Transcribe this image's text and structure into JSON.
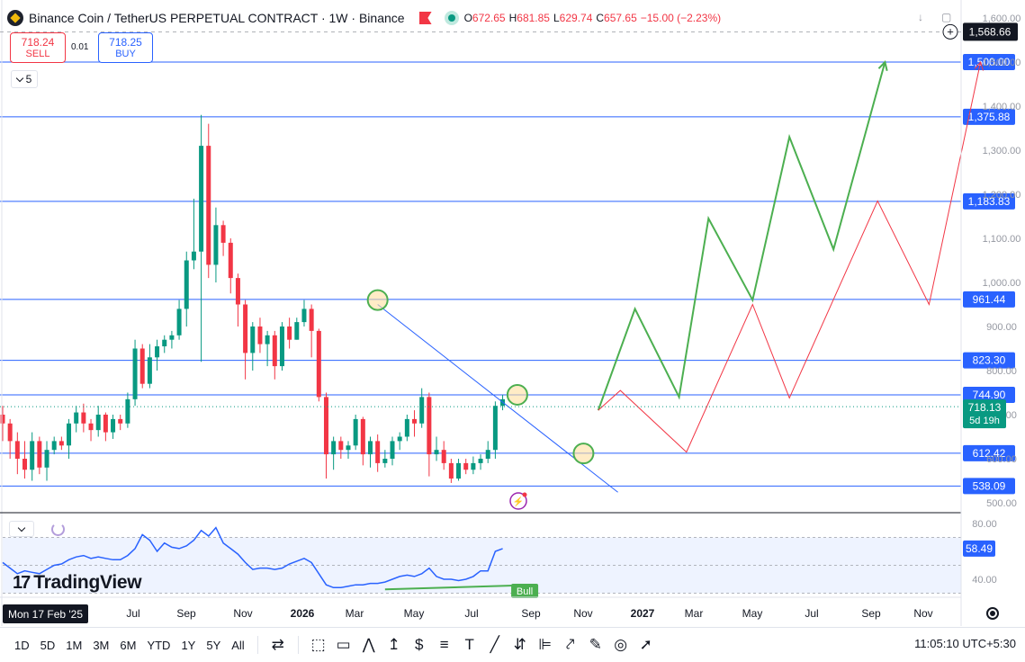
{
  "header": {
    "symbol_title": "Binance Coin / TetherUS PERPETUAL CONTRACT · 1W · Binance",
    "ohlc": [
      {
        "k": "O",
        "v": "672.65"
      },
      {
        "k": "H",
        "v": "681.85"
      },
      {
        "k": "L",
        "v": "629.74"
      },
      {
        "k": "C",
        "v": "657.65"
      },
      {
        "k": "",
        "v": "−15.00 (−2.23%)"
      }
    ],
    "sell_price": "718.24",
    "sell_label": "SELL",
    "spread": "0.01",
    "buy_price": "718.25",
    "buy_label": "BUY",
    "collapse_count": "5"
  },
  "colors": {
    "up": "#089981",
    "down": "#f23645",
    "hline": "#2962ff",
    "proj_green": "#4caf50",
    "proj_red": "#f23645",
    "rsi": "#2962ff",
    "axis_label_bg": "#2962ff",
    "last_price_bg": "#089981"
  },
  "chart_data": {
    "type": "candlestick",
    "price_axis": {
      "ticks": [
        500,
        600,
        700,
        800,
        900,
        1000,
        1100,
        1200,
        1300,
        1400,
        1500,
        1600
      ],
      "tick_labels": [
        "500.00",
        "600.00",
        "700.00",
        "800.00",
        "900.00",
        "1,000.00",
        "1,100.00",
        "1,200.00",
        "1,300.00",
        "1,400.00",
        "1,500.00",
        "1,600.00"
      ]
    },
    "time_axis": [
      "Jul",
      "Sep",
      "Nov",
      "2026",
      "Mar",
      "May",
      "Jul",
      "Sep",
      "Nov",
      "2027",
      "Mar",
      "May",
      "Jul",
      "Sep",
      "Nov"
    ],
    "crosshair_date": "Mon 17 Feb '25",
    "crosshair_price": "1,568.66",
    "last_price": "718.13",
    "countdown": "5d 19h",
    "levels": [
      {
        "price": 1500.0,
        "label": "1,500.00"
      },
      {
        "price": 1375.88,
        "label": "1,375.88"
      },
      {
        "price": 1183.83,
        "label": "1,183.83"
      },
      {
        "price": 961.44,
        "label": "961.44"
      },
      {
        "price": 823.3,
        "label": "823.30"
      },
      {
        "price": 744.9,
        "label": "744.90"
      },
      {
        "price": 612.42,
        "label": "612.42"
      },
      {
        "price": 538.09,
        "label": "538.09"
      }
    ],
    "candles": [
      [
        700,
        680,
        720,
        640
      ],
      [
        680,
        640,
        690,
        600
      ],
      [
        640,
        600,
        660,
        565
      ],
      [
        600,
        575,
        640,
        555
      ],
      [
        575,
        640,
        660,
        550
      ],
      [
        640,
        580,
        650,
        565
      ],
      [
        580,
        620,
        640,
        550
      ],
      [
        620,
        640,
        650,
        610
      ],
      [
        640,
        630,
        650,
        620
      ],
      [
        630,
        680,
        690,
        600
      ],
      [
        680,
        705,
        720,
        660
      ],
      [
        705,
        680,
        725,
        660
      ],
      [
        680,
        665,
        690,
        640
      ],
      [
        665,
        700,
        720,
        650
      ],
      [
        700,
        660,
        705,
        640
      ],
      [
        660,
        690,
        700,
        645
      ],
      [
        690,
        680,
        700,
        665
      ],
      [
        680,
        735,
        750,
        670
      ],
      [
        735,
        850,
        870,
        720
      ],
      [
        850,
        770,
        860,
        760
      ],
      [
        770,
        830,
        860,
        760
      ],
      [
        830,
        855,
        870,
        800
      ],
      [
        855,
        870,
        880,
        840
      ],
      [
        870,
        880,
        890,
        850
      ],
      [
        880,
        940,
        960,
        870
      ],
      [
        940,
        1050,
        1070,
        900
      ],
      [
        1050,
        1070,
        1190,
        1030
      ],
      [
        1070,
        1310,
        1380,
        820
      ],
      [
        1310,
        1040,
        1360,
        1010
      ],
      [
        1040,
        1130,
        1170,
        1000
      ],
      [
        1130,
        1090,
        1140,
        1060
      ],
      [
        1090,
        1010,
        1100,
        975
      ],
      [
        1010,
        950,
        1020,
        900
      ],
      [
        950,
        840,
        960,
        780
      ],
      [
        840,
        900,
        910,
        800
      ],
      [
        900,
        860,
        920,
        840
      ],
      [
        860,
        880,
        890,
        810
      ],
      [
        880,
        810,
        890,
        780
      ],
      [
        810,
        900,
        910,
        800
      ],
      [
        900,
        870,
        920,
        850
      ],
      [
        870,
        910,
        920,
        870
      ],
      [
        910,
        940,
        960,
        900
      ],
      [
        940,
        890,
        950,
        830
      ],
      [
        890,
        740,
        895,
        730
      ],
      [
        740,
        610,
        750,
        555
      ],
      [
        610,
        640,
        650,
        575
      ],
      [
        640,
        620,
        650,
        600
      ],
      [
        620,
        630,
        640,
        600
      ],
      [
        630,
        690,
        700,
        620
      ],
      [
        690,
        610,
        695,
        585
      ],
      [
        610,
        640,
        650,
        580
      ],
      [
        640,
        590,
        655,
        570
      ],
      [
        590,
        600,
        620,
        580
      ],
      [
        600,
        640,
        650,
        585
      ],
      [
        640,
        650,
        660,
        620
      ],
      [
        650,
        690,
        700,
        640
      ],
      [
        690,
        680,
        710,
        650
      ],
      [
        680,
        740,
        760,
        670
      ],
      [
        740,
        610,
        750,
        560
      ],
      [
        610,
        620,
        650,
        595
      ],
      [
        620,
        590,
        640,
        575
      ],
      [
        590,
        555,
        600,
        545
      ],
      [
        555,
        590,
        600,
        550
      ],
      [
        590,
        575,
        600,
        565
      ],
      [
        575,
        590,
        605,
        565
      ],
      [
        590,
        600,
        610,
        575
      ],
      [
        600,
        620,
        640,
        590
      ],
      [
        620,
        720,
        730,
        600
      ],
      [
        720,
        735,
        745,
        710
      ]
    ],
    "trendline": {
      "from": [
        51,
        950
      ],
      "to": [
        80,
        575
      ]
    },
    "circles": [
      [
        51,
        960
      ],
      [
        70,
        745
      ],
      [
        79,
        612
      ]
    ],
    "green_projection": [
      [
        81,
        710
      ],
      [
        86,
        940
      ],
      [
        92,
        740
      ],
      [
        96,
        1145
      ],
      [
        102,
        960
      ],
      [
        107,
        1330
      ],
      [
        113,
        1075
      ],
      [
        120,
        1500
      ]
    ],
    "red_projection": [
      [
        81,
        710
      ],
      [
        84,
        755
      ],
      [
        93,
        615
      ],
      [
        102,
        950
      ],
      [
        107,
        738
      ],
      [
        119,
        1185
      ],
      [
        126,
        950
      ],
      [
        133,
        1500
      ]
    ],
    "rsi": {
      "value_label": "58.49",
      "ticks": [
        80,
        40
      ],
      "tick_labels": [
        "80.00",
        "40.00"
      ],
      "band": [
        70,
        30
      ],
      "values": [
        52,
        48,
        44,
        46,
        45,
        44,
        47,
        50,
        51,
        54,
        56,
        57,
        55,
        56,
        55,
        54,
        54,
        57,
        62,
        72,
        68,
        60,
        66,
        63,
        62,
        64,
        68,
        75,
        71,
        77,
        66,
        62,
        58,
        52,
        47,
        48,
        48,
        47,
        48,
        51,
        53,
        55,
        52,
        44,
        36,
        34,
        34,
        35,
        36,
        36,
        37,
        37,
        38,
        40,
        42,
        43,
        42,
        44,
        48,
        42,
        40,
        40,
        39,
        40,
        42,
        46,
        46,
        60,
        62
      ],
      "divergence": [
        [
          52,
          34
        ],
        [
          71,
          37
        ]
      ],
      "divergence_label": "Bull"
    }
  },
  "toolbar": {
    "timeframes": [
      "1D",
      "5D",
      "1M",
      "3M",
      "6M",
      "YTD",
      "1Y",
      "5Y",
      "All"
    ],
    "clock": "11:05:10 UTC+5:30"
  },
  "branding": "TradingView"
}
